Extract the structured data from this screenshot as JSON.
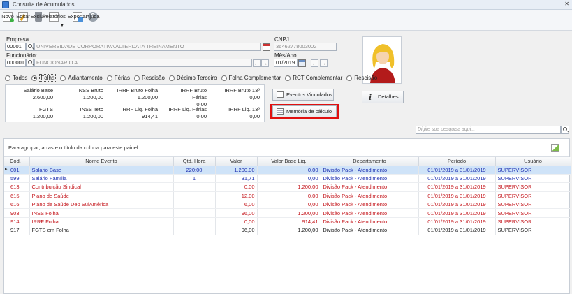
{
  "window": {
    "title": "Consulta de Acumulados",
    "close": "✕"
  },
  "toolbar": {
    "novo": "Novo",
    "editar": "Editar",
    "excluir": "Excluir",
    "relatorios": "Relatórios",
    "exportar": "Exportar",
    "ajuda": "Ajuda"
  },
  "empresa": {
    "label": "Empresa",
    "code": "00001",
    "name": "UNIVERSIDADE CORPORATIVA ALTERDATA TREINAMENTO"
  },
  "cnpj": {
    "label": "CNPJ",
    "value": "36462778003002"
  },
  "funcionario": {
    "label": "Funcionário:",
    "code": "000001",
    "name": "FUNCIONARIO A"
  },
  "mesano": {
    "label": "Mês/Ano",
    "value": "01/2019"
  },
  "radios": [
    {
      "label": "Todos",
      "selected": false
    },
    {
      "label": "Folha",
      "selected": true
    },
    {
      "label": "Adiantamento",
      "selected": false
    },
    {
      "label": "Férias",
      "selected": false
    },
    {
      "label": "Rescisão",
      "selected": false
    },
    {
      "label": "Décimo Terceiro",
      "selected": false
    },
    {
      "label": "Folha Complementar",
      "selected": false
    },
    {
      "label": "RCT Complementar",
      "selected": false
    },
    {
      "label": "Rescisão",
      "selected": false
    }
  ],
  "summary": {
    "salario_base": {
      "label": "Salário Base",
      "value": "2.600,00"
    },
    "inss_bruto": {
      "label": "INSS Bruto",
      "value": "1.200,00"
    },
    "irrf_bruto_folha": {
      "label": "IRRF Bruto Folha",
      "value": "1.200,00"
    },
    "irrf_bruto_ferias": {
      "label": "IRRF Bruto Férias",
      "value": "0,00"
    },
    "irrf_bruto_13": {
      "label": "IRRF Bruto 13º",
      "value": "0,00"
    },
    "fgts": {
      "label": "FGTS",
      "value": "1.200,00"
    },
    "inss_teto": {
      "label": "INSS Teto",
      "value": "1.200,00"
    },
    "irrf_liq_folha": {
      "label": "IRRF Liq. Folha",
      "value": "914,41"
    },
    "irrf_liq_ferias": {
      "label": "IRRF Liq. Férias",
      "value": "0,00"
    },
    "irrf_liq_13": {
      "label": "IRRF Liq. 13º",
      "value": "0,00"
    }
  },
  "buttons": {
    "eventos": "Eventos Vinculados",
    "memoria": "Memória de cálculo",
    "detalhes": "Detalhes"
  },
  "search": {
    "placeholder": "Digite sua pesquisa aqui..."
  },
  "grid": {
    "group_hint": "Para agrupar, arraste o título da coluna para este painel.",
    "columns": [
      "Cód.",
      "Nome Evento",
      "Qtd. Hora",
      "Valor",
      "Valor Base Liq.",
      "Departamento",
      "Período",
      "Usuário"
    ],
    "rows": [
      {
        "cod": "001",
        "nome": "Salário Base",
        "qtd": "220:00",
        "valor": "1.200,00",
        "base": "0,00",
        "depto": "Divisão Pack - Atendimento",
        "periodo": "01/01/2019 a 31/01/2019",
        "usuario": "SUPERVISOR",
        "color": "blue",
        "selected": true
      },
      {
        "cod": "599",
        "nome": "Salário Família",
        "qtd": "1",
        "valor": "31,71",
        "base": "0,00",
        "depto": "Divisão Pack - Atendimento",
        "periodo": "01/01/2019 a 31/01/2019",
        "usuario": "SUPERVISOR",
        "color": "blue",
        "selected": false
      },
      {
        "cod": "613",
        "nome": "Contribuição Sindical",
        "qtd": "",
        "valor": "0,00",
        "base": "1.200,00",
        "depto": "Divisão Pack - Atendimento",
        "periodo": "01/01/2019 a 31/01/2019",
        "usuario": "SUPERVISOR",
        "color": "red",
        "selected": false
      },
      {
        "cod": "615",
        "nome": "Plano de Saúde",
        "qtd": "",
        "valor": "12,00",
        "base": "0,00",
        "depto": "Divisão Pack - Atendimento",
        "periodo": "01/01/2019 a 31/01/2019",
        "usuario": "SUPERVISOR",
        "color": "red",
        "selected": false
      },
      {
        "cod": "616",
        "nome": "Plano de Saúde Dep SulAmérica",
        "qtd": "",
        "valor": "6,00",
        "base": "0,00",
        "depto": "Divisão Pack - Atendimento",
        "periodo": "01/01/2019 a 31/01/2019",
        "usuario": "SUPERVISOR",
        "color": "red",
        "selected": false
      },
      {
        "cod": "903",
        "nome": "INSS Folha",
        "qtd": "",
        "valor": "96,00",
        "base": "1.200,00",
        "depto": "Divisão Pack - Atendimento",
        "periodo": "01/01/2019 a 31/01/2019",
        "usuario": "SUPERVISOR",
        "color": "red",
        "selected": false
      },
      {
        "cod": "914",
        "nome": "IRRF Folha",
        "qtd": "",
        "valor": "0,00",
        "base": "914,41",
        "depto": "Divisão Pack - Atendimento",
        "periodo": "01/01/2019 a 31/01/2019",
        "usuario": "SUPERVISOR",
        "color": "red",
        "selected": false
      },
      {
        "cod": "917",
        "nome": "FGTS em Folha",
        "qtd": "",
        "valor": "96,00",
        "base": "1.200,00",
        "depto": "Divisão Pack - Atendimento",
        "periodo": "01/01/2019 a 31/01/2019",
        "usuario": "SUPERVISOR",
        "color": "black",
        "selected": false
      }
    ]
  },
  "colors": {
    "blue_row": "#1c2fb0",
    "red_row": "#c4161c",
    "highlight": "#e01010",
    "selected_row": "#cfe3f8"
  }
}
